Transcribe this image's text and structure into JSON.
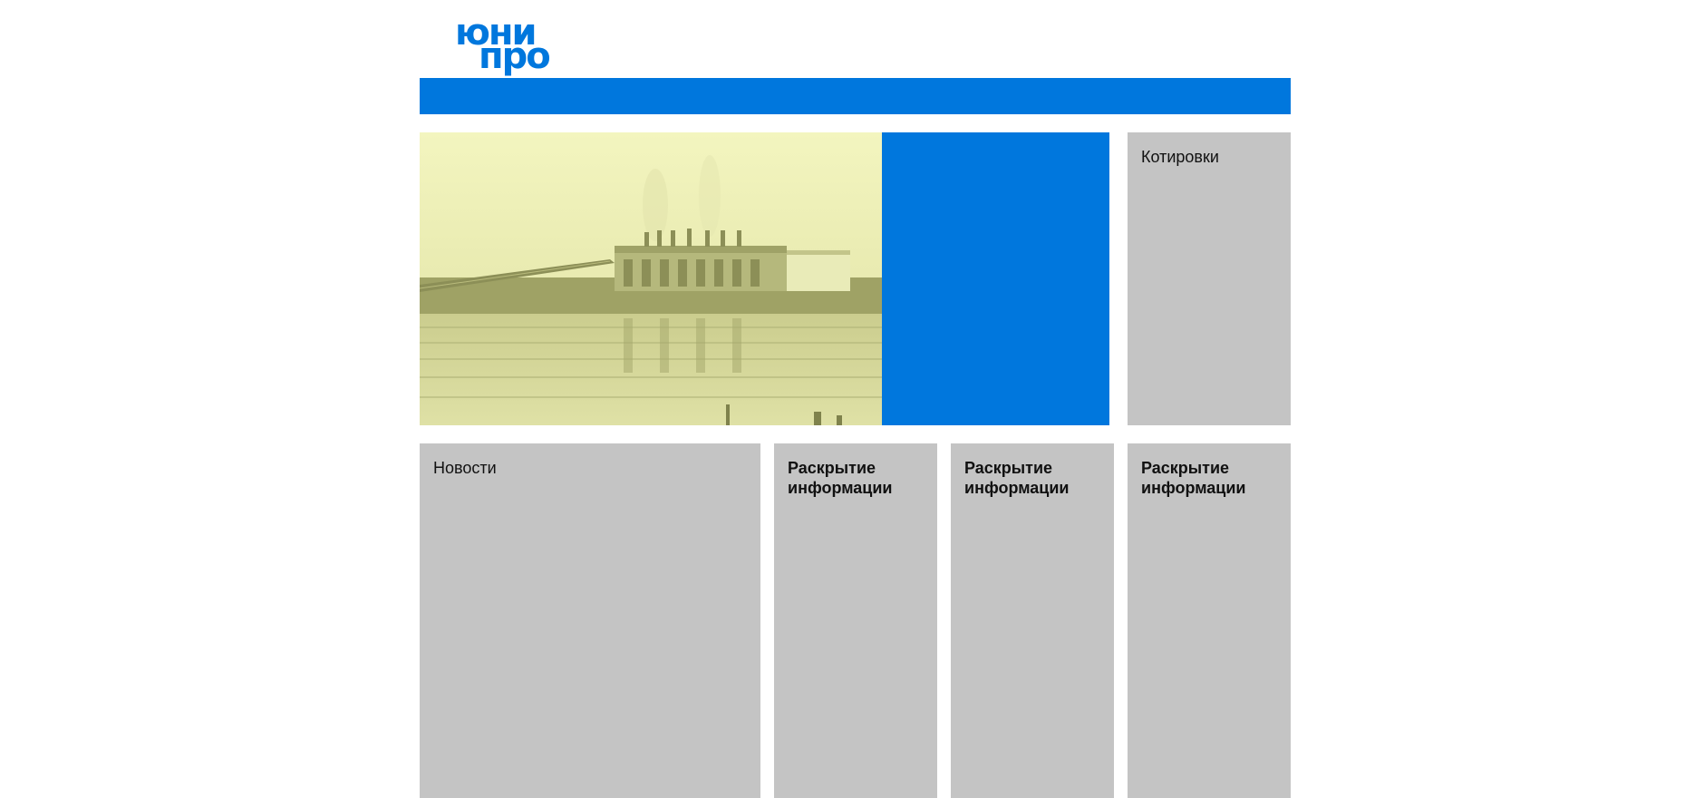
{
  "logo": {
    "line1": "юни",
    "line2": "про"
  },
  "colors": {
    "brand_blue": "#0077dd",
    "tile_gray": "#c4c4c4",
    "image_tint": "#eef0b6"
  },
  "hero": {
    "image_icon": "power-plant-photo"
  },
  "quotes": {
    "title": "Котировки"
  },
  "news": {
    "title": "Новости"
  },
  "disclosure": [
    {
      "title": "Раскрытие информации"
    },
    {
      "title": "Раскрытие информации"
    },
    {
      "title": "Раскрытие информации"
    }
  ]
}
